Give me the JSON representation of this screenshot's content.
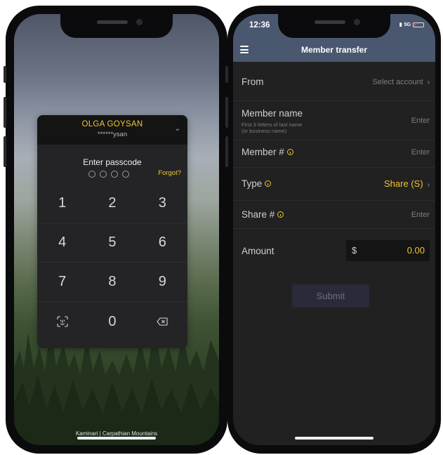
{
  "lock_screen": {
    "user_name": "OLGA GOYSAN",
    "masked_user": "******ysan",
    "prompt": "Enter passcode",
    "forgot_label": "Forgot?",
    "keys": [
      "1",
      "2",
      "3",
      "4",
      "5",
      "6",
      "7",
      "8",
      "9",
      "0"
    ],
    "photo_credit": "Kaminari | Carpathian Mountains"
  },
  "transfer_screen": {
    "status_time": "12:36",
    "network": "5G",
    "header_title": "Member transfer",
    "from": {
      "label": "From",
      "value": "Select account"
    },
    "member_name": {
      "label": "Member name",
      "hint_line1": "First 3 letters of last name",
      "hint_line2": "(or business name)",
      "placeholder": "Enter"
    },
    "member_number": {
      "label": "Member #",
      "placeholder": "Enter"
    },
    "type": {
      "label": "Type",
      "value": "Share (S)"
    },
    "share_number": {
      "label": "Share #",
      "placeholder": "Enter"
    },
    "amount": {
      "label": "Amount",
      "currency": "$",
      "value": "0.00"
    },
    "submit_label": "Submit"
  },
  "colors": {
    "accent": "#f2c531",
    "header_bg": "#49576f",
    "app_bg": "#212121",
    "card_bg": "#242426"
  }
}
